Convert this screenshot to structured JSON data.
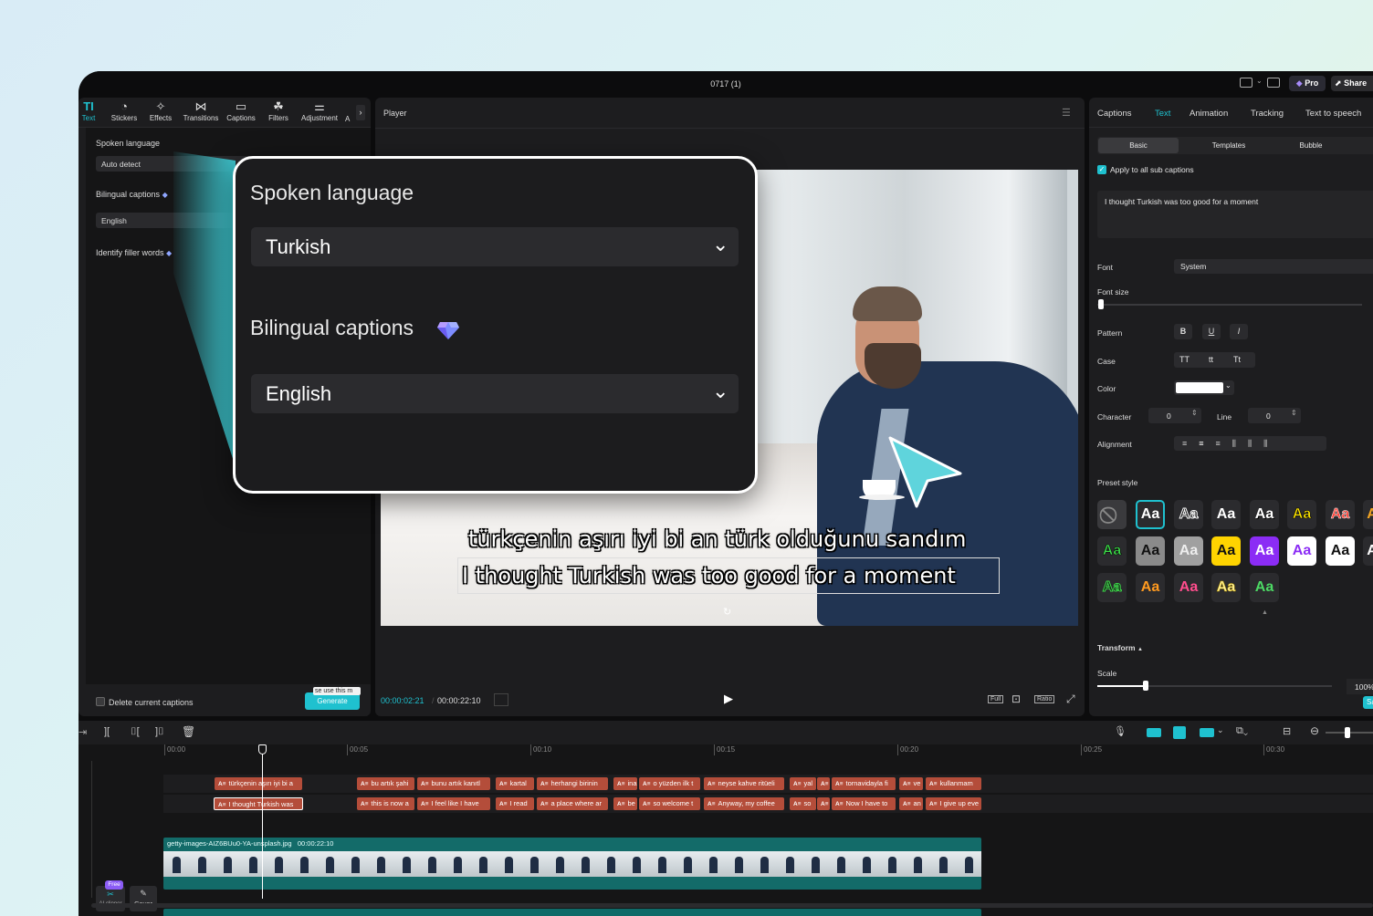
{
  "window": {
    "title": "0717 (1)",
    "pro_label": "Pro",
    "share_label": "Share"
  },
  "toolbar": {
    "items": [
      {
        "label": "Text",
        "icon": "TI"
      },
      {
        "label": "Stickers",
        "icon": "◔"
      },
      {
        "label": "Effects",
        "icon": "✧"
      },
      {
        "label": "Transitions",
        "icon": "⋈"
      },
      {
        "label": "Captions",
        "icon": "▭"
      },
      {
        "label": "Filters",
        "icon": "☘"
      },
      {
        "label": "Adjustment",
        "icon": "⚌"
      }
    ],
    "more_label": "A"
  },
  "left_panel": {
    "spoken_language_label": "Spoken language",
    "spoken_language_value": "Auto detect",
    "bilingual_label": "Bilingual captions",
    "bilingual_value": "English",
    "filler_label": "Identify filler words",
    "delete_label": "Delete current captions",
    "generate_label": "Generate",
    "generate_tooltip": "se use this m"
  },
  "zoom_callout": {
    "spoken_language_label": "Spoken language",
    "spoken_language_value": "Turkish",
    "bilingual_label": "Bilingual captions",
    "bilingual_value": "English"
  },
  "player": {
    "title": "Player",
    "caption_line1": "türkçenin aşırı iyi bi an türk olduğunu sandım",
    "caption_line2": "I thought Turkish was too good for a moment",
    "current_time": "00:00:02:21",
    "total_time": "00:00:22:10",
    "full_label": "Full",
    "ratio_label": "Ratio"
  },
  "right_panel": {
    "tabs": [
      "Captions",
      "Text",
      "Animation",
      "Tracking",
      "Text to speech"
    ],
    "active_tab": "Text",
    "subtabs": [
      "Basic",
      "Templates",
      "Bubble"
    ],
    "apply_all_label": "Apply to all sub captions",
    "caption_text": "I thought Turkish was too good for a moment",
    "font_label": "Font",
    "font_value": "System",
    "font_size_label": "Font size",
    "pattern_label": "Pattern",
    "pattern_b": "B",
    "pattern_u": "U",
    "pattern_i": "I",
    "case_label": "Case",
    "case_upper": "TT",
    "case_lower": "tt",
    "case_title": "Tt",
    "color_label": "Color",
    "color_value": "#ffffff",
    "character_label": "Character",
    "character_value": "0",
    "line_label": "Line",
    "line_value": "0",
    "alignment_label": "Alignment",
    "preset_label": "Preset style",
    "preset_text": "Aa",
    "transform_label": "Transform",
    "scale_label": "Scale",
    "scale_value": "100%",
    "save_label": "Sa"
  },
  "accent_color": "#1fc1cf",
  "timeline": {
    "ticks": [
      "00:00",
      "00:05",
      "00:10",
      "00:15",
      "00:20",
      "00:25",
      "00:30"
    ],
    "row1": [
      {
        "t": "türkçenin aşırı iyi bi a"
      },
      {
        "t": "bu artık şahi"
      },
      {
        "t": "bunu artık kanıtl"
      },
      {
        "t": "kartal"
      },
      {
        "t": "herhangi birinin"
      },
      {
        "t": "ina"
      },
      {
        "t": "o yüzden ilk t"
      },
      {
        "t": "neyse kahve ritüeli"
      },
      {
        "t": "yal"
      },
      {
        "t": ""
      },
      {
        "t": "tornavidayla fi"
      },
      {
        "t": "ve"
      },
      {
        "t": "kullanmam"
      }
    ],
    "row2": [
      {
        "t": "I thought Turkish was"
      },
      {
        "t": "this is now a"
      },
      {
        "t": "I feel like I have"
      },
      {
        "t": "I read"
      },
      {
        "t": "a place where ar"
      },
      {
        "t": "be"
      },
      {
        "t": "so welcome t"
      },
      {
        "t": "Anyway, my coffee"
      },
      {
        "t": "so"
      },
      {
        "t": ""
      },
      {
        "t": "Now I have to"
      },
      {
        "t": "an"
      },
      {
        "t": "I give up eve"
      }
    ],
    "video_name": "getty-images-AIZ6BUu0-YA-unsplash.jpg",
    "video_duration": "00:00:22:10",
    "free_badge": "Free",
    "clipper_label": "AI clipper",
    "cover_label": "Cover"
  }
}
